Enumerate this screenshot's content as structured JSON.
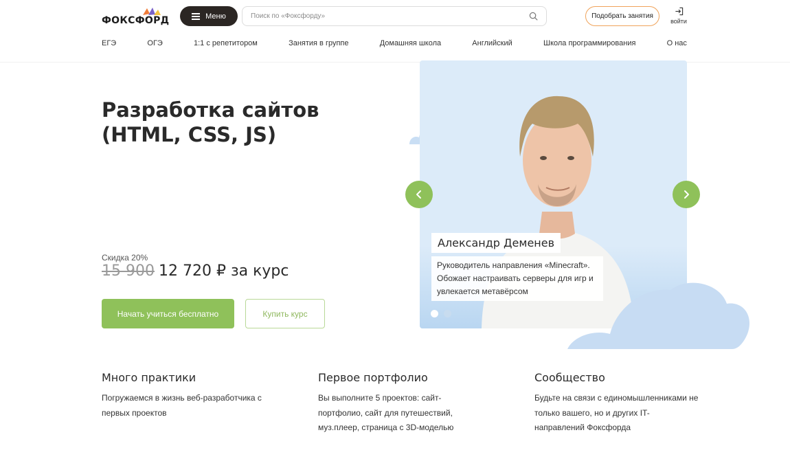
{
  "header": {
    "logo_text": "ФОКСФОРД",
    "menu_label": "Меню",
    "search_placeholder": "Поиск по «Фоксфорду»",
    "pick_label": "Подобрать занятия",
    "login_label": "войти"
  },
  "nav": {
    "items": [
      {
        "label": "ЕГЭ"
      },
      {
        "label": "ОГЭ"
      },
      {
        "label": "1:1 с репетитором"
      },
      {
        "label": "Занятия в группе"
      },
      {
        "label": "Домашняя школа"
      },
      {
        "label": "Английский"
      },
      {
        "label": "Школа программирования"
      },
      {
        "label": "О нас"
      }
    ]
  },
  "hero": {
    "title": "Разработка сайтов (HTML, CSS, JS)",
    "discount": "Скидка 20%",
    "old_price": "15 900",
    "new_price": "12 720 ₽ за курс",
    "start_button": "Начать учиться бесплатно",
    "buy_button": "Купить курс"
  },
  "slider": {
    "teacher_name": "Александр Деменев",
    "teacher_desc": "Руководитель направления «Minecraft». Обожает настраивать серверы для игр и увлекается метавёрсом",
    "active_slide": 1,
    "slide_count": 2
  },
  "features": [
    {
      "title": "Много практики",
      "text": "Погружаемся в жизнь веб-разработчика с первых проектов"
    },
    {
      "title": "Первое портфолио",
      "text": "Вы выполните 5 проектов: сайт-портфолио, сайт для путешествий, муз.плеер, страница с 3D-моделью"
    },
    {
      "title": "Сообщество",
      "text": "Будьте на связи с единомышленниками не только вашего, но и других IT-направлений Фоксфорда"
    }
  ],
  "colors": {
    "accent_green": "#8fc15a",
    "dark": "#2b2623",
    "orange_outline": "#f0a35a",
    "slider_bg": "#dcebf9"
  }
}
